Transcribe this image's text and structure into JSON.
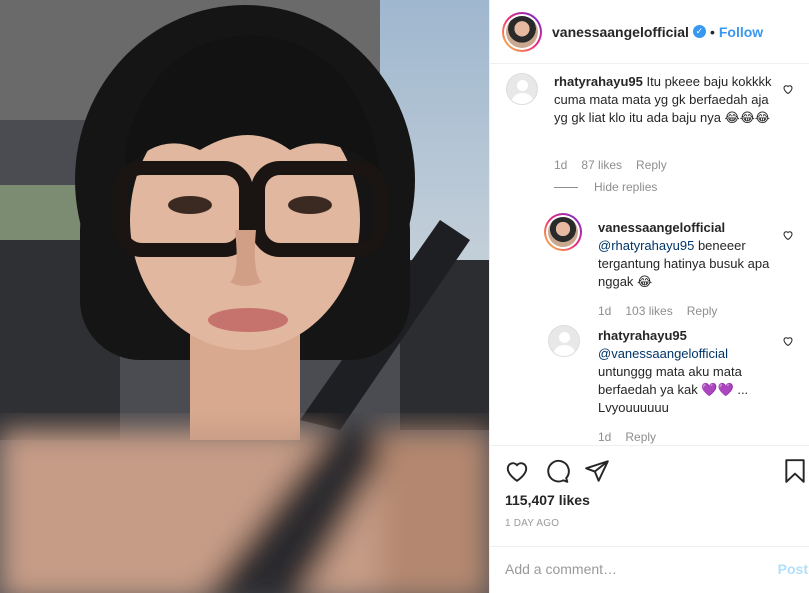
{
  "post": {
    "username": "vanessaangelofficial",
    "verified_badge": "✓",
    "separator": "•",
    "follow_label": "Follow",
    "likes": "115,407 likes",
    "time_ago": "1 DAY AGO",
    "add_comment_placeholder": "Add a comment…",
    "post_label": "Post"
  },
  "comments": [
    {
      "username": "rhatyrahayu95",
      "text": "Itu pkeee baju kokkkk cuma mata mata yg gk berfaedah aja yg gk liat klo itu ada baju nya 😂😂😂",
      "age": "1d",
      "likes": "87 likes",
      "reply_label": "Reply",
      "hide_replies_label": "Hide replies",
      "replies": [
        {
          "username": "vanessaangelofficial",
          "mention": "@rhatyrahayu95",
          "text": "beneeer tergantung hatinya busuk apa nggak 😂",
          "age": "1d",
          "likes": "103 likes",
          "reply_label": "Reply"
        },
        {
          "username": "rhatyrahayu95",
          "mention": "@vanessaangelofficial",
          "text": "untunggg mata aku mata berfaedah ya kak 💜💜 ... Lvyouuuuuu",
          "age": "1d",
          "reply_label": "Reply"
        }
      ]
    }
  ],
  "icons": [
    "heart-icon",
    "comment-icon",
    "share-icon",
    "bookmark-icon",
    "verified-badge-icon",
    "avatar-placeholder-icon"
  ],
  "colors": {
    "link": "#3897f0",
    "mention": "#003569",
    "muted": "#8e8e8e",
    "border": "#efefef"
  }
}
